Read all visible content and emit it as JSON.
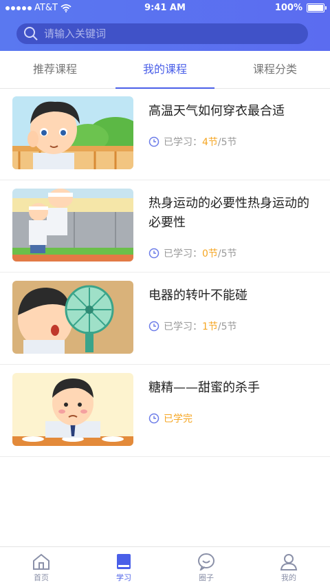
{
  "status": {
    "carrier": "AT&T",
    "time": "9:41 AM",
    "battery": "100%"
  },
  "search": {
    "placeholder": "请输入关键词"
  },
  "tabs": [
    {
      "label": "推荐课程",
      "active": false
    },
    {
      "label": "我的课程",
      "active": true
    },
    {
      "label": "课程分类",
      "active": false
    }
  ],
  "courses": [
    {
      "title": "高温天气如何穿衣最合适",
      "prefix": "已学习：",
      "done_count": "4节",
      "total": "/5节"
    },
    {
      "title": "热身运动的必要性热身运动的必要性",
      "prefix": "已学习：",
      "done_count": "0节",
      "total": "/5节"
    },
    {
      "title": "电器的转叶不能碰",
      "prefix": "已学习：",
      "done_count": "1节",
      "total": "/5节"
    },
    {
      "title": "糖精——甜蜜的杀手",
      "completed": "已学完"
    }
  ],
  "bottom_tabs": [
    {
      "label": "首页",
      "icon": "home-icon"
    },
    {
      "label": "学习",
      "icon": "book-icon",
      "active": true
    },
    {
      "label": "圈子",
      "icon": "chat-bubble-icon"
    },
    {
      "label": "我的",
      "icon": "user-icon"
    }
  ],
  "colors": {
    "primary": "#4a5fe8",
    "accent": "#f5a623"
  }
}
